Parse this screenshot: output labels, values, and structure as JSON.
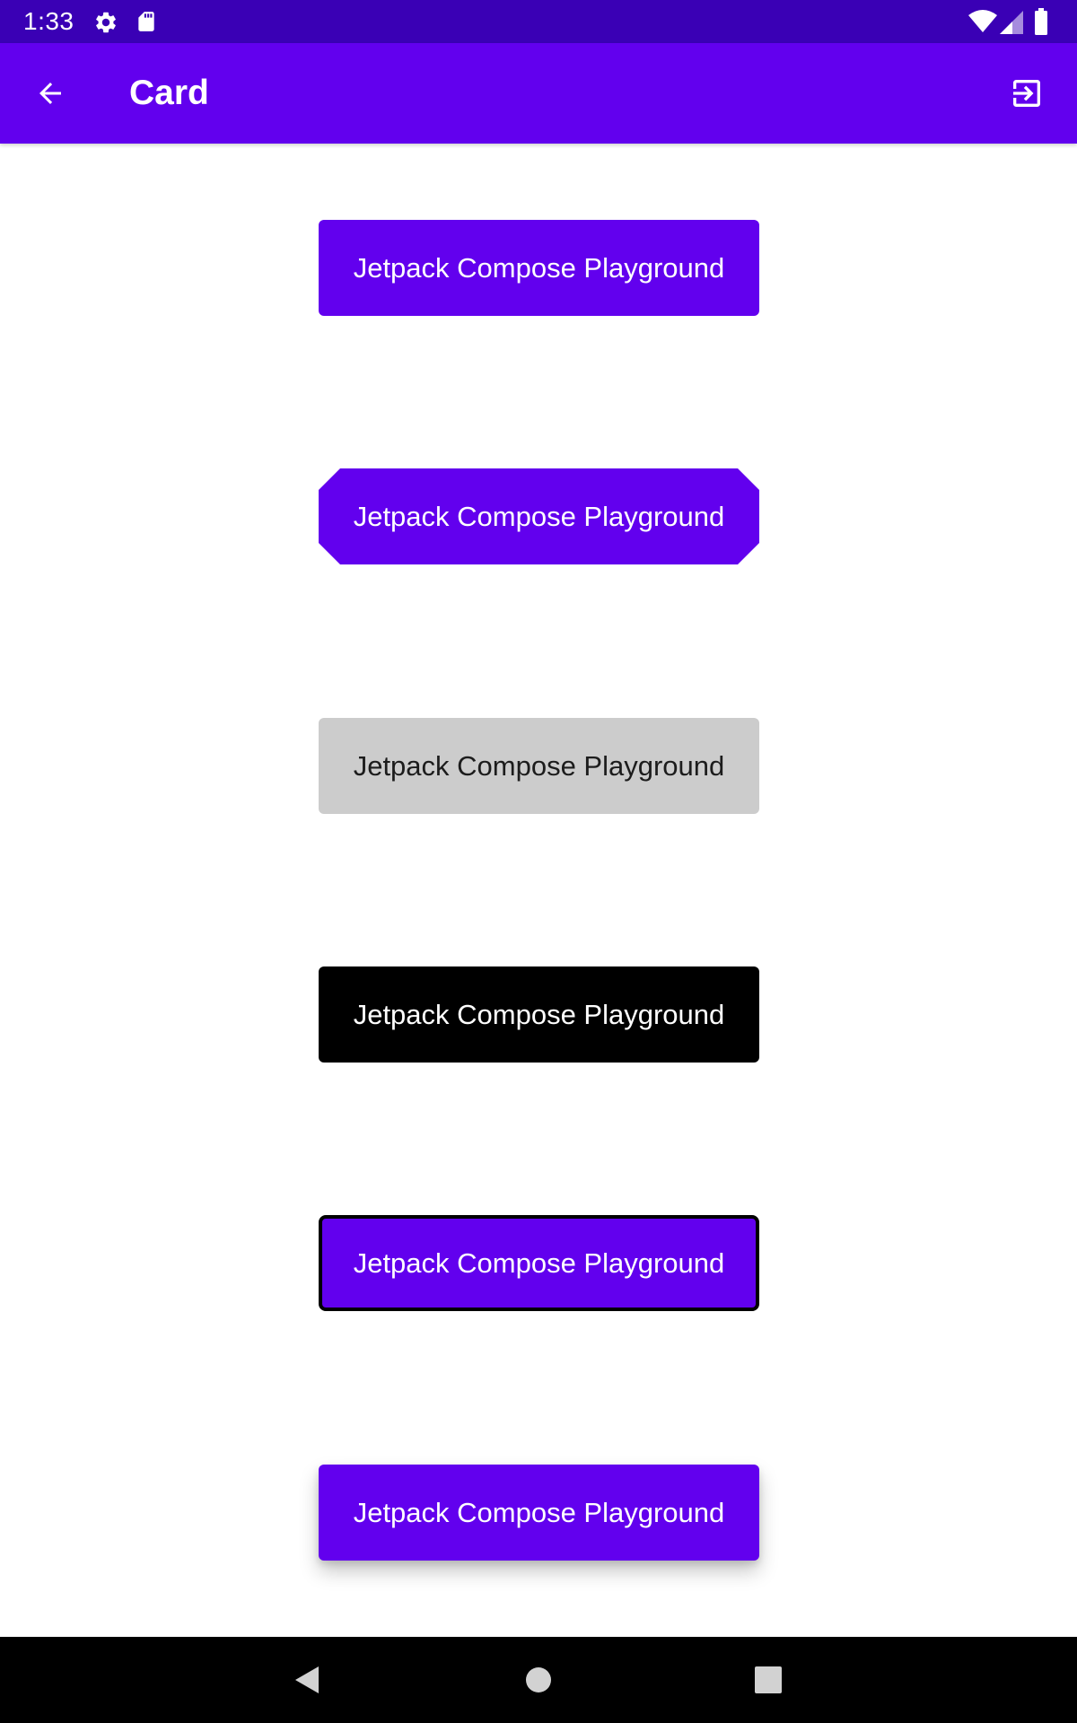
{
  "status_bar": {
    "time": "1:33",
    "icons": [
      "settings-icon",
      "sd-card-icon",
      "wifi-icon",
      "cellular-signal-icon",
      "battery-icon"
    ],
    "background": "#3a00b5"
  },
  "app_bar": {
    "title": "Card",
    "back_icon": "arrow-back-icon",
    "action_icon": "exit-to-app-icon",
    "background": "#6200ee"
  },
  "cards": [
    {
      "label": "Jetpack Compose Playground",
      "style": "rounded",
      "background": "#6200ee",
      "text_color": "#ffffff"
    },
    {
      "label": "Jetpack Compose Playground",
      "style": "cut-corner",
      "background": "#6200ee",
      "text_color": "#ffffff"
    },
    {
      "label": "Jetpack Compose Playground",
      "style": "rounded",
      "background": "#cccccc",
      "text_color": "#1c1c1c"
    },
    {
      "label": "Jetpack Compose Playground",
      "style": "rounded",
      "background": "#000000",
      "text_color": "#ffffff"
    },
    {
      "label": "Jetpack Compose Playground",
      "style": "bordered",
      "background": "#6200ee",
      "text_color": "#ffffff",
      "border_color": "#000000"
    },
    {
      "label": "Jetpack Compose Playground",
      "style": "elevated",
      "background": "#6200ee",
      "text_color": "#ffffff"
    }
  ],
  "nav_bar": {
    "buttons": [
      "back-triangle-icon",
      "home-circle-icon",
      "recents-square-icon"
    ],
    "background": "#000000"
  }
}
